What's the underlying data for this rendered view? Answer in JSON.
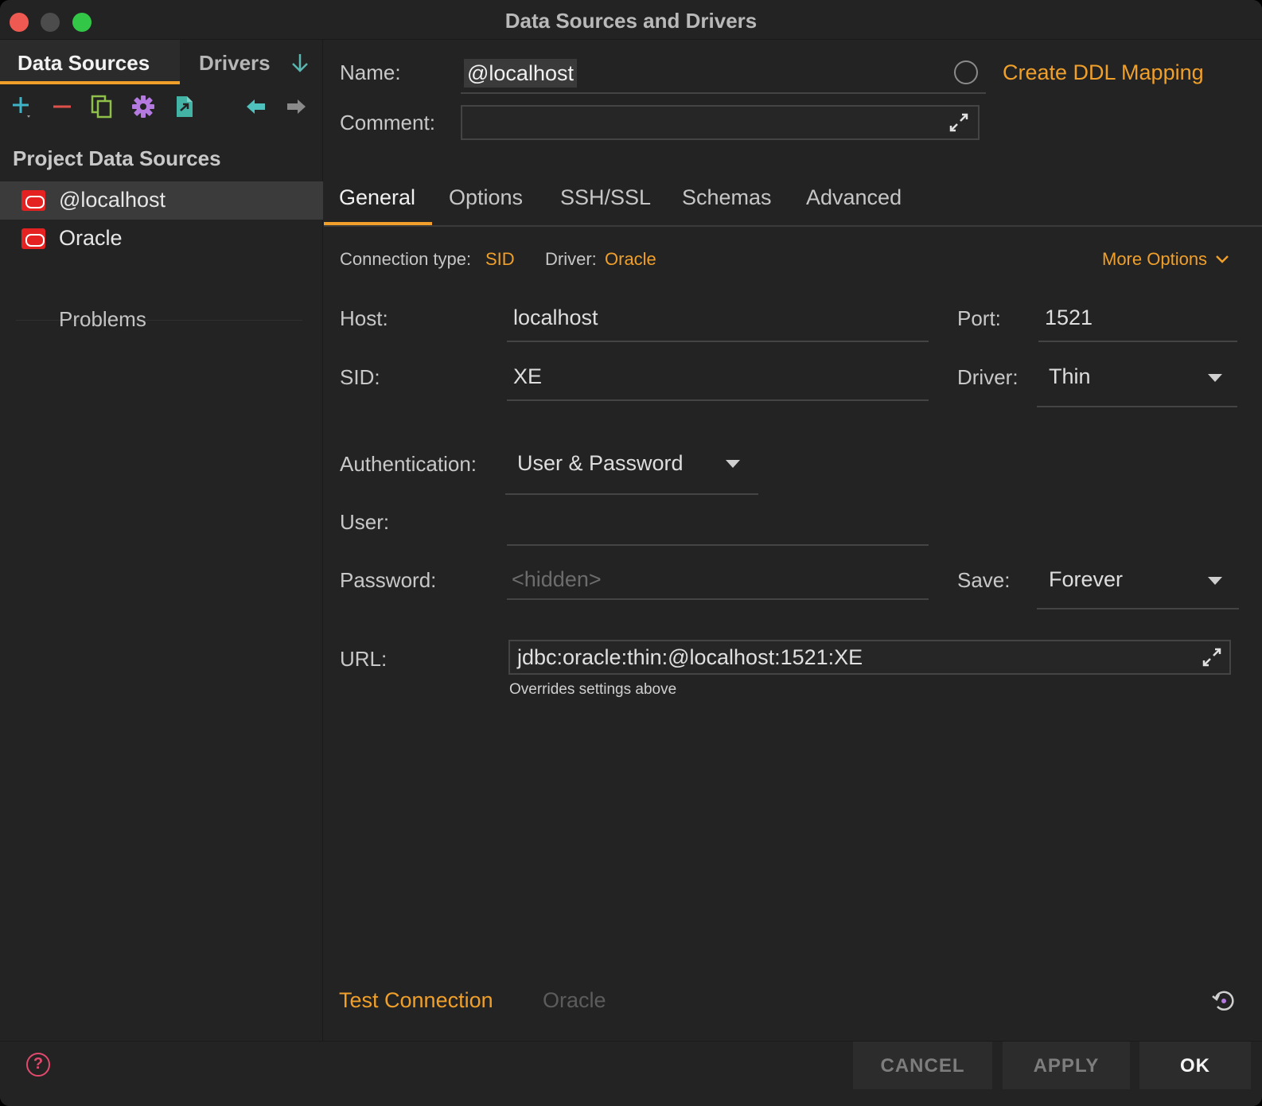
{
  "window": {
    "title": "Data Sources and Drivers"
  },
  "left": {
    "tabs": {
      "data_sources": "Data Sources",
      "drivers": "Drivers"
    },
    "toolbar_icons": [
      "add-icon",
      "remove-icon",
      "copy-icon",
      "settings-icon",
      "import-icon",
      "back-icon",
      "forward-icon"
    ],
    "section_title": "Project Data Sources",
    "items": [
      {
        "label": "@localhost",
        "selected": true,
        "icon": "oracle-icon"
      },
      {
        "label": "Oracle",
        "selected": false,
        "icon": "oracle-icon"
      }
    ],
    "problems": "Problems"
  },
  "form": {
    "name_label": "Name:",
    "name_value": "@localhost",
    "ddl_link": "Create DDL Mapping",
    "comment_label": "Comment:",
    "comment_value": "",
    "tabs": [
      "General",
      "Options",
      "SSH/SSL",
      "Schemas",
      "Advanced"
    ],
    "connection_type_label": "Connection type:",
    "connection_type_value": "SID",
    "driver_label": "Driver:",
    "driver_value": "Oracle",
    "more_options": "More Options",
    "host_label": "Host:",
    "host_value": "localhost",
    "port_label": "Port:",
    "port_value": "1521",
    "sid_label": "SID:",
    "sid_value": "XE",
    "driver2_label": "Driver:",
    "driver2_value": "Thin",
    "auth_label": "Authentication:",
    "auth_value": "User & Password",
    "user_label": "User:",
    "user_value": "",
    "password_label": "Password:",
    "password_placeholder": "<hidden>",
    "save_label": "Save:",
    "save_value": "Forever",
    "url_label": "URL:",
    "url_value": "jdbc:oracle:thin:@localhost:1521:XE",
    "url_hint": "Overrides settings above",
    "test_connection": "Test Connection",
    "test_driver": "Oracle"
  },
  "buttons": {
    "cancel": "CANCEL",
    "apply": "APPLY",
    "ok": "OK",
    "help": "?"
  },
  "colors": {
    "accent": "#f0a02a",
    "oracle_red": "#e52222",
    "background": "#232323"
  }
}
